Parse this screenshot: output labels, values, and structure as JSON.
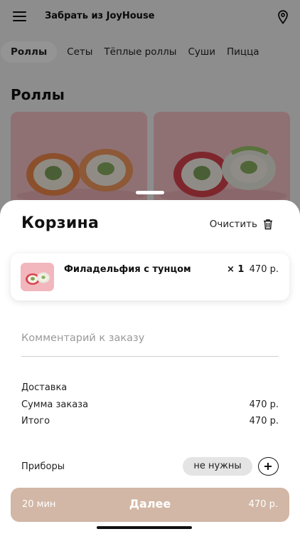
{
  "header": {
    "title": "Забрать из JoyHouse",
    "menu_icon": "hamburger-icon",
    "location_icon": "map-pin-icon"
  },
  "categories": [
    "Роллы",
    "Сеты",
    "Тёплые роллы",
    "Суши",
    "Пицца"
  ],
  "active_category": "Роллы",
  "section_title": "Роллы",
  "cart": {
    "title": "Корзина",
    "clear_label": "Очистить",
    "clear_icon": "trash-icon",
    "items": [
      {
        "name": "Филадельфия с тунцом",
        "qty": "× 1",
        "price": "470 р."
      }
    ],
    "comment_placeholder": "Комментарий к заказу",
    "delivery_label": "Доставка",
    "subtotal_label": "Сумма заказа",
    "subtotal_value": "470 р.",
    "total_label": "Итого",
    "total_value": "470 р.",
    "cutlery_label": "Приборы",
    "cutlery_value": "не нужны",
    "next": {
      "time": "20 мин",
      "label": "Далее",
      "sum": "470 р."
    }
  },
  "colors": {
    "accent": "#d2b7a6",
    "roll_pink": "#f6c3c8"
  }
}
